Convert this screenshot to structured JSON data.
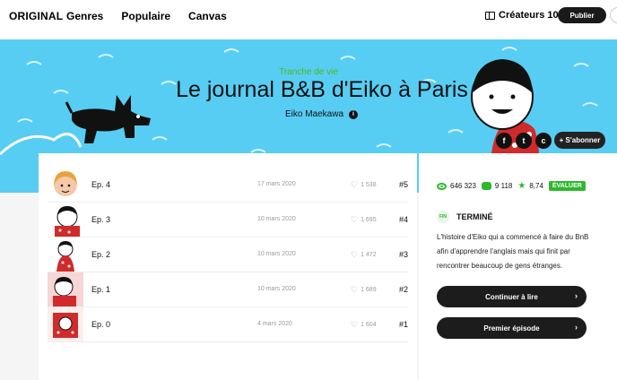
{
  "nav": {
    "brand": "ORIGINAL",
    "links": [
      "Genres",
      "Populaire",
      "Canvas"
    ],
    "creators": "Créateurs 101",
    "publish": "Publier"
  },
  "series": {
    "genre": "Tranche de vie",
    "title": "Le journal B&B d'Eiko à Paris",
    "author": "Eiko Maekawa",
    "subscribe": "+ S'abonner",
    "social": [
      "f",
      "t",
      "c"
    ]
  },
  "episodes": [
    {
      "title": "Ep. 4",
      "date": "17 mars 2020",
      "likes": "1 538",
      "num": "#5"
    },
    {
      "title": "Ep. 3",
      "date": "10 mars 2020",
      "likes": "1 695",
      "num": "#4"
    },
    {
      "title": "Ep. 2",
      "date": "10 mars 2020",
      "likes": "1 472",
      "num": "#3"
    },
    {
      "title": "Ep. 1",
      "date": "10 mars 2020",
      "likes": "1 689",
      "num": "#2"
    },
    {
      "title": "Ep. 0",
      "date": "4 mars 2020",
      "likes": "1 604",
      "num": "#1"
    }
  ],
  "stats": {
    "views": "646 323",
    "subscribers": "9 118",
    "rating": "8,74",
    "rate_label": "ÉVALUER"
  },
  "status": {
    "badge": "FIN",
    "label": "TERMINÉ"
  },
  "description": "L'histoire d'Eiko qui a commencé à faire du BnB afin d'apprendre l'anglais mais qui finit par rencontrer beaucoup de gens étranges.",
  "buttons": {
    "continue": "Continuer à lire",
    "first": "Premier épisode"
  },
  "colors": {
    "banner": "#57cdf3",
    "accent": "#2db82d",
    "genre": "#4cbb17"
  }
}
